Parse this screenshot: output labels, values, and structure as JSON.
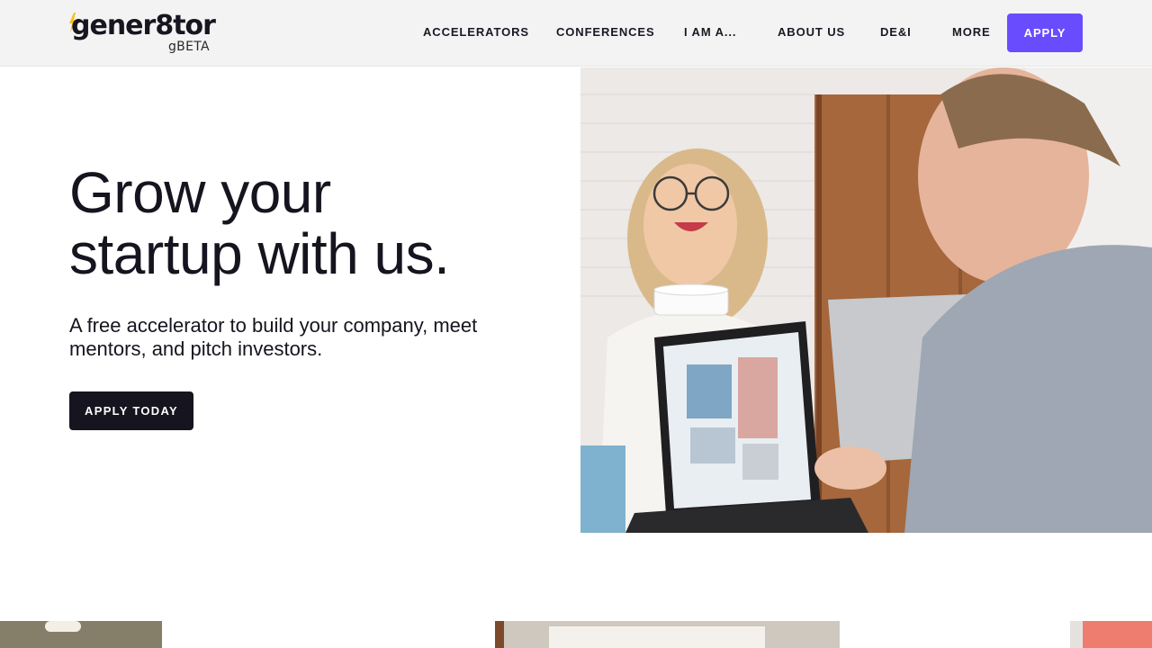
{
  "brand": {
    "logo_text": "gener8tor",
    "logo_sub": "gBETA",
    "bolt_color": "#f4c21b"
  },
  "nav": {
    "items": [
      {
        "label": "ACCELERATORS"
      },
      {
        "label": "CONFERENCES"
      },
      {
        "label": "I AM A..."
      },
      {
        "label": "ABOUT US"
      },
      {
        "label": "DE&I"
      },
      {
        "label": "MORE"
      }
    ],
    "apply_label": "APPLY",
    "accent": "#6a4cff"
  },
  "hero": {
    "title_line1": "Grow your",
    "title_line2": "startup with us.",
    "subtitle": "A free accelerator to build your company, meet mentors, and pitch investors.",
    "cta_label": "APPLY TODAY"
  }
}
